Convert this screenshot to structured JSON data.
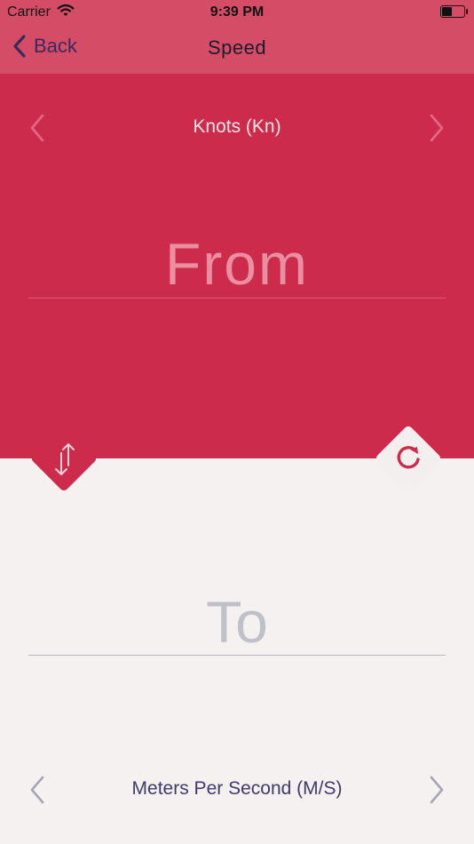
{
  "status_bar": {
    "carrier": "Carrier",
    "time": "9:39 PM",
    "battery_level": 0.45
  },
  "nav": {
    "back_label": "Back",
    "title": "Speed"
  },
  "from": {
    "unit": "Knots (Kn)",
    "placeholder": "From"
  },
  "to": {
    "unit": "Meters Per Second (M/S)",
    "placeholder": "To"
  },
  "colors": {
    "header": "#d54c67",
    "from_panel": "#cd2b4c",
    "to_panel": "#f5f1f0",
    "to_text": "#3e3a6e"
  },
  "icons": [
    "back-chevron-icon",
    "chevron-left-icon",
    "chevron-right-icon",
    "swap-vertical-icon",
    "reset-icon",
    "wifi-icon",
    "battery-icon"
  ]
}
